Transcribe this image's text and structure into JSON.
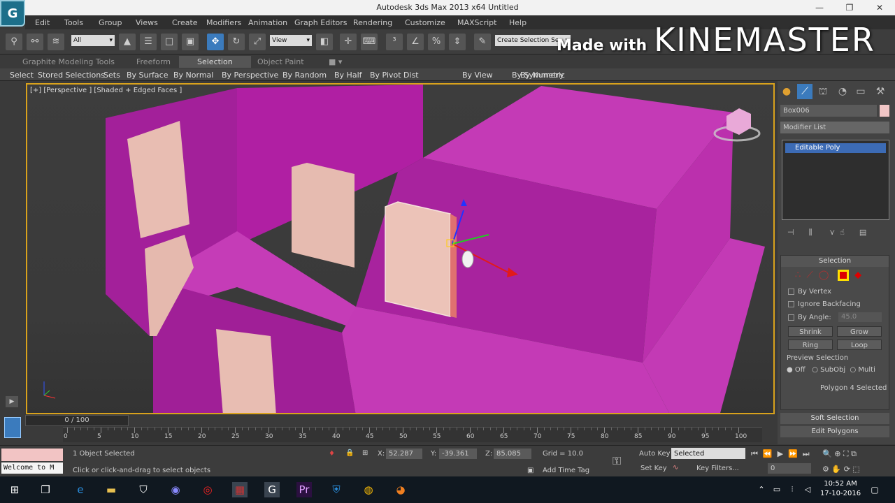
{
  "window": {
    "title": "Autodesk 3ds Max  2013 x64       Untitled",
    "app_icon": "3ds-max-logo-icon"
  },
  "menu": [
    "Edit",
    "Tools",
    "Group",
    "Views",
    "Create",
    "Modifiers",
    "Animation",
    "Graph Editors",
    "Rendering",
    "Customize",
    "MAXScript",
    "Help"
  ],
  "toolbar": {
    "filter": "All",
    "ref_coord": "View",
    "named_selection": "Create Selection Se"
  },
  "watermark": {
    "made_with": "Made with",
    "brand": "KINEMASTER"
  },
  "ribbon": {
    "tabs": [
      "Graphite Modeling Tools",
      "Freeform",
      "Selection",
      "Object Paint"
    ],
    "active_tab": "Selection",
    "items": [
      "Select",
      "Stored Selections",
      "Sets",
      "By Surface",
      "By Normal",
      "By Perspective",
      "By Random",
      "By Half",
      "By Pivot Dist",
      "By View",
      "By Symmetry",
      "By Numeric"
    ]
  },
  "viewport": {
    "label": "[+] [Perspective ] [Shaded + Edged Faces ]",
    "object_color": "#b827a8",
    "selected_color": "#e6b5a8"
  },
  "command_panel": {
    "object_name": "Box006",
    "modifier_list": "Modifier List",
    "stack": [
      "Editable Poly"
    ],
    "selection": {
      "header": "Selection",
      "by_vertex": "By Vertex",
      "ignore_backfacing": "Ignore Backfacing",
      "by_angle": "By Angle:",
      "angle_value": "45.0",
      "shrink": "Shrink",
      "grow": "Grow",
      "ring": "Ring",
      "loop": "Loop",
      "preview_header": "Preview Selection",
      "preview_options": [
        "Off",
        "SubObj",
        "Multi"
      ],
      "status": "Polygon 4 Selected"
    },
    "soft_selection": "Soft Selection",
    "edit_polygons": "Edit Polygons"
  },
  "timeline": {
    "frame_display": "0 / 100",
    "ticks": [
      0,
      5,
      10,
      15,
      20,
      25,
      30,
      35,
      40,
      45,
      50,
      55,
      60,
      65,
      70,
      75,
      80,
      85,
      90,
      95,
      100
    ]
  },
  "status": {
    "objects_selected": "1 Object Selected",
    "prompt": "Click or click-and-drag to select objects",
    "x_label": "X:",
    "x": "52.287",
    "y_label": "Y:",
    "y": "-39.361",
    "z_label": "Z:",
    "z": "85.085",
    "grid": "Grid = 10.0",
    "add_time_tag": "Add Time Tag",
    "auto_key": "Auto Key",
    "set_key": "Set Key",
    "key_mode": "Selected",
    "key_filters": "Key Filters...",
    "frame": "0",
    "maxscript": "Welcome to M"
  },
  "taskbar": {
    "time": "10:52 AM",
    "date": "17-10-2016"
  }
}
